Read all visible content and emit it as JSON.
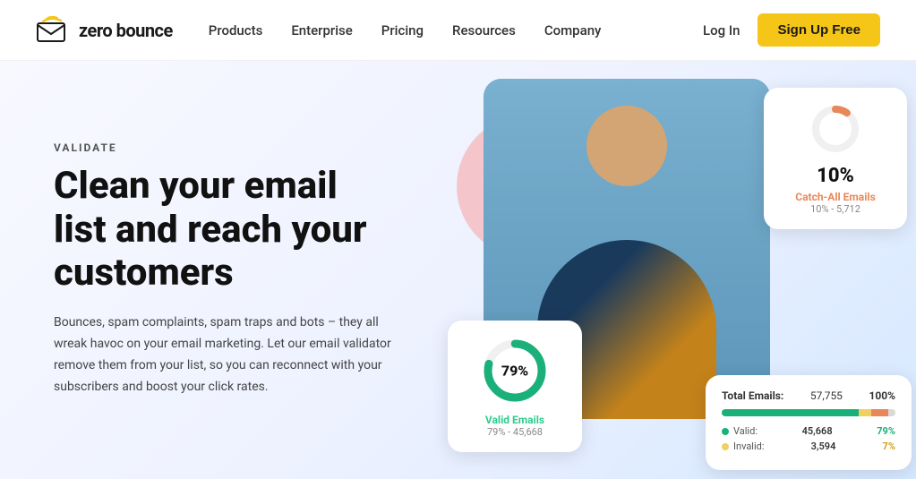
{
  "nav": {
    "logo_text": "zero bounce",
    "links": [
      {
        "label": "Products",
        "id": "products"
      },
      {
        "label": "Enterprise",
        "id": "enterprise"
      },
      {
        "label": "Pricing",
        "id": "pricing"
      },
      {
        "label": "Resources",
        "id": "resources"
      },
      {
        "label": "Company",
        "id": "company"
      }
    ],
    "login_label": "Log In",
    "signup_label": "Sign Up Free"
  },
  "hero": {
    "validate_label": "VALIDATE",
    "title": "Clean your email list and reach your customers",
    "description": "Bounces, spam complaints, spam traps and bots – they all wreak havoc on your email marketing. Let our email validator remove them from your list, so you can reconnect with your subscribers and boost your click rates."
  },
  "card_catchall": {
    "percent": "10%",
    "label": "Catch-All Emails",
    "sub": "10% - 5,712"
  },
  "card_valid": {
    "percent": "79%",
    "label": "Valid Emails",
    "sub": "79% - 45,668"
  },
  "card_totals": {
    "title": "Total Emails:",
    "total_num": "57,755",
    "total_pct": "100%",
    "rows": [
      {
        "label": "Valid:",
        "value": "45,668",
        "pct": "79%",
        "pct_color": "valid"
      },
      {
        "label": "Invalid:",
        "value": "3,594",
        "pct": "7%",
        "pct_color": "invalid"
      }
    ]
  }
}
